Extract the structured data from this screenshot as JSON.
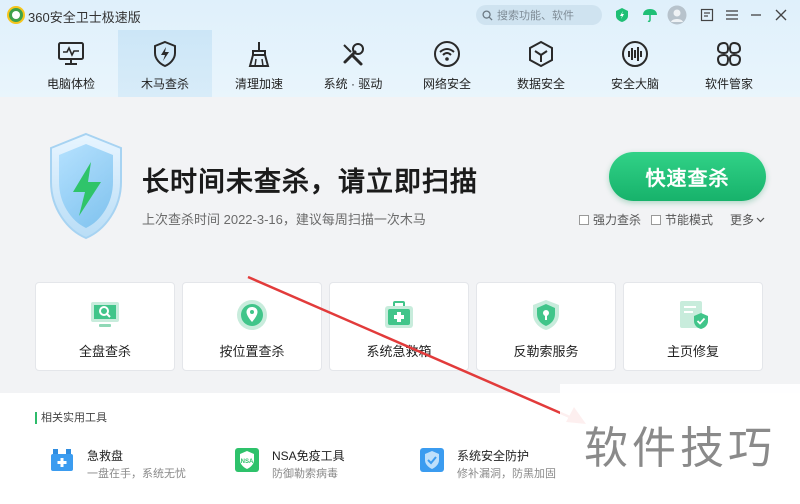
{
  "titlebar": {
    "app_title": "360安全卫士极速版",
    "search_placeholder": "搜索功能、软件",
    "icons": [
      "lightning-icon",
      "umbrella-icon",
      "avatar-icon",
      "feedback-icon",
      "menu-icon",
      "close-icon"
    ]
  },
  "nav": {
    "items": [
      {
        "label": "电脑体检",
        "icon": "monitor-icon"
      },
      {
        "label": "木马查杀",
        "icon": "shield-icon",
        "active": true
      },
      {
        "label": "清理加速",
        "icon": "broom-icon"
      },
      {
        "label": "系统 · 驱动",
        "icon": "wrench-icon"
      },
      {
        "label": "网络安全",
        "icon": "wifi-icon"
      },
      {
        "label": "数据安全",
        "icon": "hexagon-icon"
      },
      {
        "label": "安全大脑",
        "icon": "brain-icon"
      },
      {
        "label": "软件管家",
        "icon": "apps-icon"
      }
    ]
  },
  "hero": {
    "headline": "长时间未查杀，请立即扫描",
    "subline": "上次查杀时间 2022-3-16，建议每周扫描一次木马",
    "scan_button": "快速查杀",
    "options": {
      "strong": "强力查杀",
      "power_save": "节能模式",
      "more": "更多"
    }
  },
  "cards": [
    {
      "label": "全盘查杀",
      "icon": "monitor-search-icon"
    },
    {
      "label": "按位置查杀",
      "icon": "location-icon"
    },
    {
      "label": "系统急救箱",
      "icon": "first-aid-kit-icon"
    },
    {
      "label": "反勒索服务",
      "icon": "shield-lock-icon"
    },
    {
      "label": "主页修复",
      "icon": "page-shield-icon"
    }
  ],
  "tools": {
    "section_title": "相关实用工具",
    "items": [
      {
        "name": "急救盘",
        "desc": "一盘在手，系统无忧",
        "icon": "rescue-disk-icon"
      },
      {
        "name": "NSA免疫工具",
        "desc": "防御勒索病毒",
        "icon": "nsa-shield-icon"
      },
      {
        "name": "系统安全防护",
        "desc": "修补漏洞，防黑加固",
        "icon": "system-shield-icon"
      }
    ]
  },
  "watermark": "软件技巧",
  "colors": {
    "accent_green": "#1fbf75",
    "arrow_red": "#e23b3b",
    "header_bg": "#e3f2fb"
  }
}
